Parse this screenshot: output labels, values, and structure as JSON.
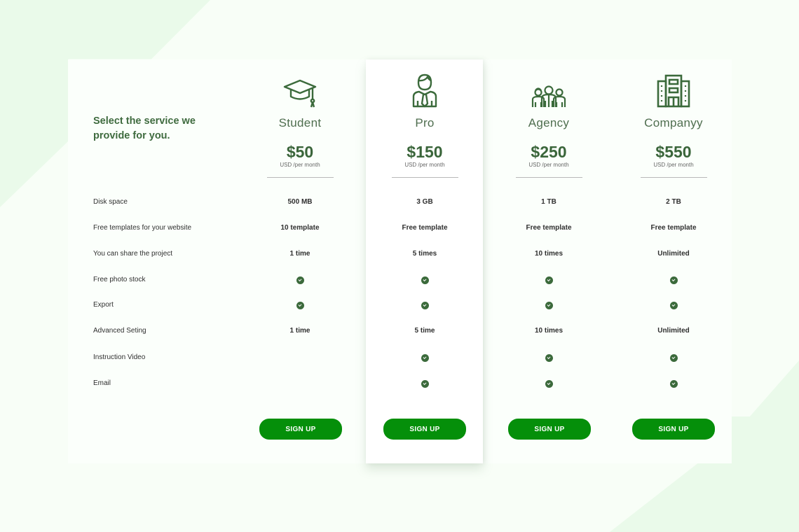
{
  "intro": "Select the service we provide for you.",
  "colors": {
    "accent": "#058f0a",
    "icon": "#3b6a3b",
    "price": "#3a653a",
    "background": "#f8fef7",
    "background_shape": "#eafaea"
  },
  "features": [
    "Disk space",
    "Free templates for your website",
    "You can share the project",
    "Free photo stock",
    "Export",
    "Advanced Seting",
    "Instruction Video",
    "Email"
  ],
  "plans": [
    {
      "icon": "graduation-cap-icon",
      "name": "Student",
      "price": "$50",
      "period": "USD /per month",
      "values": [
        "500 MB",
        "10 template",
        "1 time",
        "check",
        "check",
        "1 time",
        "",
        ""
      ],
      "button": "SIGN UP"
    },
    {
      "icon": "businessman-icon",
      "name": "Pro",
      "price": "$150",
      "period": "USD /per month",
      "values": [
        "3 GB",
        "Free template",
        "5 times",
        "check",
        "check",
        "5 time",
        "check",
        "check"
      ],
      "button": "SIGN UP",
      "highlighted": true
    },
    {
      "icon": "team-icon",
      "name": "Agency",
      "price": "$250",
      "period": "USD /per month",
      "values": [
        "1 TB",
        "Free template",
        "10 times",
        "check",
        "check",
        "10 times",
        "check",
        "check"
      ],
      "button": "SIGN UP"
    },
    {
      "icon": "building-icon",
      "name": "Companyy",
      "price": "$550",
      "period": "USD /per month",
      "values": [
        "2 TB",
        "Free template",
        "Unlimited",
        "check",
        "check",
        "Unlimited",
        "check",
        "check"
      ],
      "button": "SIGN UP"
    }
  ]
}
